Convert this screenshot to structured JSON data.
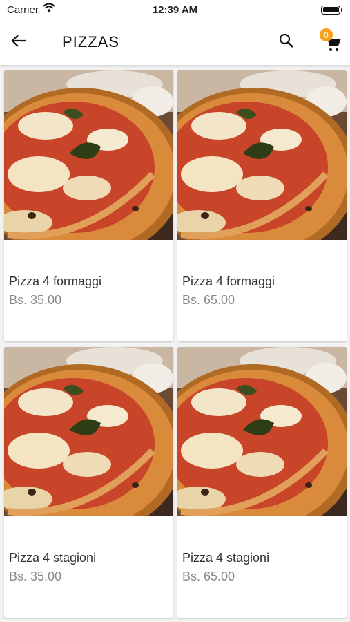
{
  "status": {
    "carrier": "Carrier",
    "time": "12:39 AM",
    "battery_level": 1.0
  },
  "appbar": {
    "title": "PIZZAS",
    "cart_count": "0"
  },
  "colors": {
    "badge": "#f9a01b",
    "text": "#333333",
    "price": "#888888"
  },
  "icons": {
    "back": "arrow-left-icon",
    "search": "search-icon",
    "cart": "cart-icon",
    "wifi": "wifi-icon",
    "battery": "battery-icon"
  },
  "products": [
    {
      "name": "Pizza 4 formaggi",
      "price": "Bs. 35.00"
    },
    {
      "name": "Pizza 4 formaggi",
      "price": "Bs. 65.00"
    },
    {
      "name": "Pizza 4 stagioni",
      "price": "Bs. 35.00"
    },
    {
      "name": "Pizza 4 stagioni",
      "price": "Bs. 65.00"
    }
  ]
}
